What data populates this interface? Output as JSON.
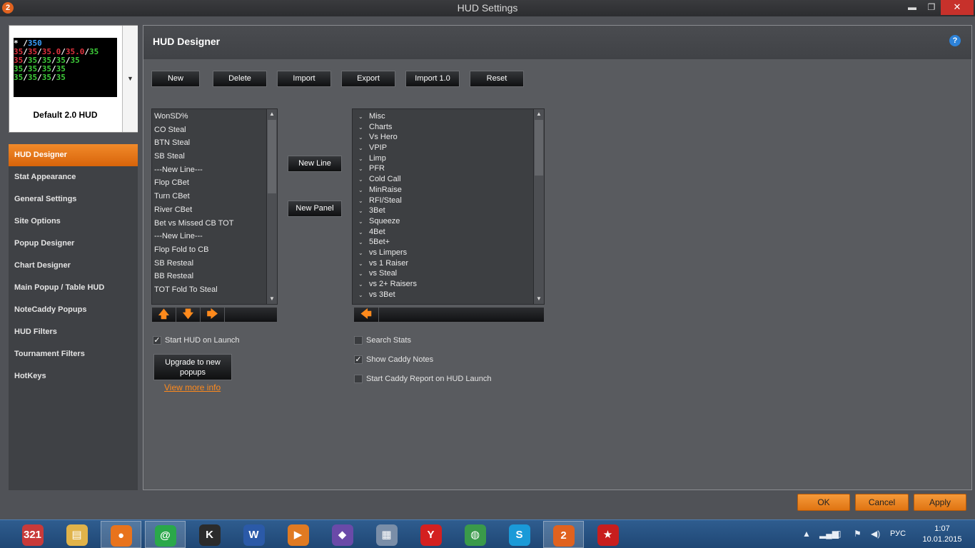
{
  "window": {
    "title": "HUD Settings",
    "app_icon_text": "2",
    "min_label": "▬",
    "max_label": "❐",
    "close_label": "✕"
  },
  "hud_preview": {
    "name": "Default 2.0 HUD",
    "line1": [
      "* /",
      "350"
    ],
    "line2": [
      "35",
      "35",
      "35.0",
      "35.0",
      "35"
    ],
    "line3": [
      "35",
      "35",
      "35",
      "35",
      "35"
    ],
    "line4": [
      "35",
      "35",
      "35",
      "35"
    ],
    "line5": [
      "35",
      "35",
      "35",
      "35"
    ],
    "dropdown_icon": "▼"
  },
  "sidebar": {
    "items": [
      {
        "label": "HUD Designer",
        "active": true
      },
      {
        "label": "Stat Appearance"
      },
      {
        "label": "General Settings"
      },
      {
        "label": "Site Options"
      },
      {
        "label": "Popup Designer"
      },
      {
        "label": "Chart Designer"
      },
      {
        "label": "Main Popup / Table HUD"
      },
      {
        "label": "NoteCaddy Popups"
      },
      {
        "label": "HUD Filters"
      },
      {
        "label": "Tournament Filters"
      },
      {
        "label": "HotKeys"
      }
    ]
  },
  "main": {
    "title": "HUD Designer",
    "help_icon": "?",
    "toolbar": {
      "new": "New",
      "delete": "Delete",
      "import": "Import",
      "export": "Export",
      "import10": "Import 1.0",
      "reset": "Reset"
    },
    "hud_stats": [
      "WonSD%",
      "CO Steal",
      "BTN Steal",
      "SB Steal",
      "---New Line---",
      "Flop CBet",
      "Turn CBet",
      "River CBet",
      "Bet vs Missed CB TOT",
      "---New Line---",
      "Flop Fold to CB",
      "SB Resteal",
      "BB Resteal",
      "TOT Fold To Steal"
    ],
    "new_line": "New Line",
    "new_panel": "New Panel",
    "stat_categories": [
      "Misc",
      "Charts",
      "Vs Hero",
      "VPIP",
      "Limp",
      "PFR",
      "Cold Call",
      "MinRaise",
      "RFI/Steal",
      "3Bet",
      "Squeeze",
      "4Bet",
      "5Bet+",
      "vs Limpers",
      "vs 1 Raiser",
      "vs Steal",
      "vs 2+ Raisers",
      "vs 3Bet"
    ],
    "arrows": {
      "up": "🡅",
      "down": "🡇",
      "right": "🡆",
      "left": "🡄"
    },
    "options": {
      "start_hud": {
        "label": "Start HUD on Launch",
        "checked": true
      },
      "search_stats": {
        "label": "Search Stats",
        "checked": false
      },
      "show_caddy": {
        "label": "Show Caddy Notes",
        "checked": true
      },
      "caddy_report": {
        "label": "Start Caddy Report on HUD Launch",
        "checked": false
      }
    },
    "upgrade_button": "Upgrade to new popups",
    "view_more": "View more info"
  },
  "footer": {
    "ok": "OK",
    "cancel": "Cancel",
    "apply": "Apply"
  },
  "taskbar": {
    "apps": [
      {
        "name": "calendar",
        "label": "321",
        "color": "#c83a3a"
      },
      {
        "name": "file-explorer",
        "label": "▤",
        "color": "#e0b34a"
      },
      {
        "name": "firefox",
        "label": "●",
        "color": "#e8731c",
        "active": true
      },
      {
        "name": "mail-agent",
        "label": "@",
        "color": "#2aa84a",
        "active": true
      },
      {
        "name": "k-app",
        "label": "K",
        "color": "#2b2b2b"
      },
      {
        "name": "word",
        "label": "W",
        "color": "#2b5aa8"
      },
      {
        "name": "media-player",
        "label": "▶",
        "color": "#e07a22"
      },
      {
        "name": "visual-studio",
        "label": "◆",
        "color": "#6a4aa8"
      },
      {
        "name": "monitor-app",
        "label": "▦",
        "color": "#7a8ea8"
      },
      {
        "name": "yandex",
        "label": "Y",
        "color": "#d42020"
      },
      {
        "name": "globe-app",
        "label": "◍",
        "color": "#3a9a4a"
      },
      {
        "name": "skype",
        "label": "S",
        "color": "#1a9ad8"
      },
      {
        "name": "hud-app",
        "label": "2",
        "color": "#e0621f",
        "active": true
      },
      {
        "name": "pokerstars",
        "label": "★",
        "color": "#c81e1e"
      }
    ],
    "language": "РУС",
    "time": "1:07",
    "date": "10.01.2015"
  }
}
